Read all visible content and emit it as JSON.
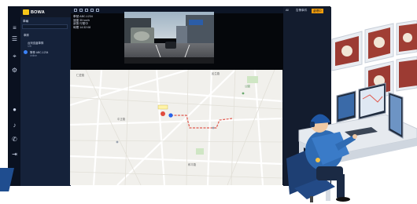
{
  "app": {
    "brand": "BOWA",
    "tree": {
      "tab": "車輛",
      "search_placeholder": "",
      "nodes": [
        {
          "label": "車隊",
          "sub": ""
        },
        {
          "label": "台灣巡邏車隊",
          "sub": "1/5"
        },
        {
          "label": "警車 ABC-1234",
          "sub": "online"
        }
      ]
    },
    "info_lines": [
      "車號 ABC-1234",
      "速度 35 km/h",
      "狀態 行駛中",
      "時間 14:32:08"
    ],
    "right_tabs": [
      "All",
      "告警事件",
      "處理中"
    ],
    "map_labels": [
      "仁愛路",
      "中正路",
      "民生路",
      "和平路",
      "公園"
    ]
  },
  "colors": {
    "app_bg": "#111827",
    "tree_bg": "#15223a",
    "alert_accent": "#f59e0b",
    "brand_yellow": "#f5c518",
    "route_line": "#e05a4f",
    "corner_blue": "#1f4d8f"
  },
  "icons": [
    "menu-icon",
    "user-icon",
    "bell-icon",
    "phone-icon",
    "settings-icon",
    "logout-icon"
  ]
}
